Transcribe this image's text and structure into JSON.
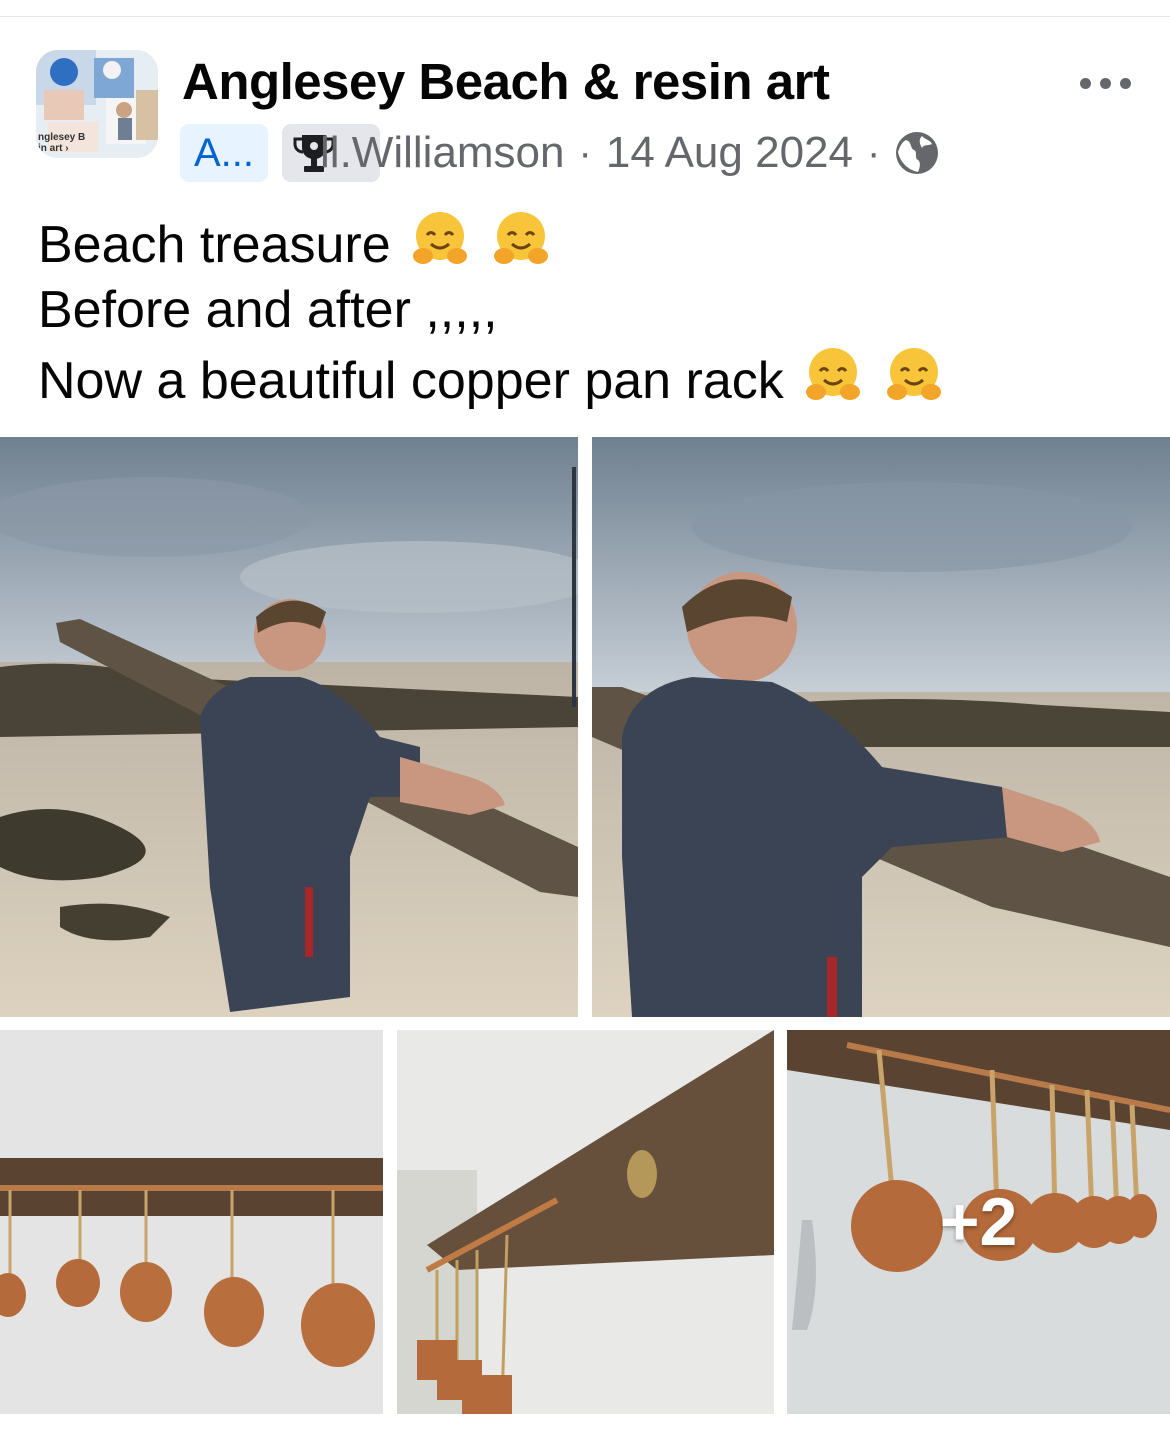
{
  "header": {
    "page_name": "Anglesey Beach & resin art",
    "avatar_caption_line1": "nglesey B",
    "avatar_caption_line2": "in art ›",
    "group_chip": "A...",
    "author": "Bill Williamson",
    "author_display": "ll.Williamson",
    "separator": "·",
    "date": "14 Aug 2024",
    "privacy_icon": "globe-icon",
    "badge_icon": "trophy-icon",
    "menu_icon": "more-horizontal-icon"
  },
  "post": {
    "lines": [
      "Beach treasure",
      "Before and after ,,,,,",
      "Now a beautiful copper pan rack"
    ],
    "emoji": "hugging-face"
  },
  "photos": {
    "items": [
      "photo-beach-before",
      "photo-beach-after",
      "photo-pan-rack-front",
      "photo-pan-rack-angle",
      "photo-pan-rack-side"
    ],
    "more_count": "+2"
  },
  "colors": {
    "link_blue": "#0064d1",
    "chip_blue_bg": "#e7f3ff",
    "meta_grey": "#65676b",
    "chip_grey_bg": "#e4e6eb"
  }
}
